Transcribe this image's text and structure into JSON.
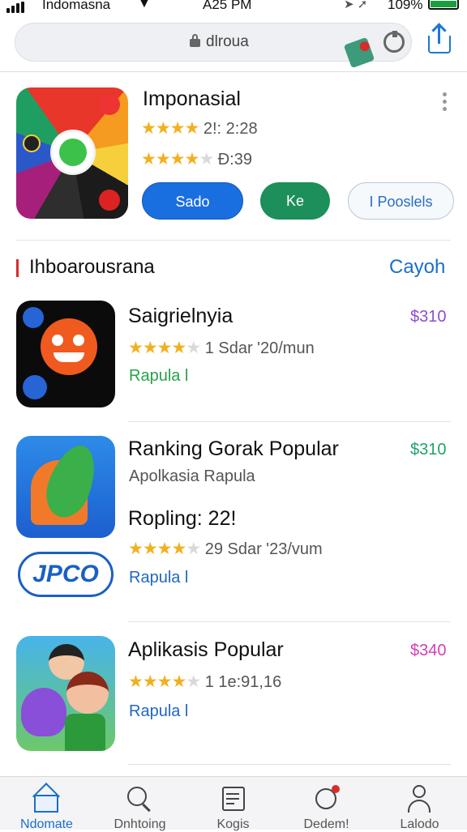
{
  "status_bar": {
    "carrier": "Indomasna",
    "time": "A25 PM",
    "battery": "109%"
  },
  "browser": {
    "url": "dlroua"
  },
  "featured": {
    "title": "Imponasial",
    "rating_line1": "2!: 2:28",
    "rating_line2": "Ð:39",
    "buttons": [
      "Sado",
      "Ke",
      "I Pooslels"
    ]
  },
  "section": {
    "title": "Ihboarousrana",
    "link": "Cayoh"
  },
  "apps": [
    {
      "title": "Saigrielnyia",
      "rating_text": "1 Sdar '20/mun",
      "price": "$310",
      "link": "Rapula l"
    },
    {
      "title": "Ranking Gorak Popular",
      "subtitle": "Apolkasia Rapula",
      "extra": "Ropling:  22!",
      "rating_text": "29 Sdar '23/vum",
      "price": "$310",
      "link": "Rapula l",
      "badge": "JPCO"
    },
    {
      "title": "Aplikasis Popular",
      "rating_text": "1 1e:91,16",
      "price": "$340",
      "link": "Rapula l"
    }
  ],
  "tabs": [
    {
      "label": "Ndomate",
      "icon": "home-icon"
    },
    {
      "label": "Dnhtoing",
      "icon": "search-icon"
    },
    {
      "label": "Kogis",
      "icon": "list-icon"
    },
    {
      "label": "Dedem!",
      "icon": "update-icon"
    },
    {
      "label": "Lalodo",
      "icon": "profile-icon"
    }
  ],
  "colors": {
    "accent_blue": "#1a6fe0",
    "green": "#1c8f5a",
    "star": "#f2b01e",
    "price_purple": "#8a4fd0",
    "price_green": "#1fa36a",
    "price_magenta": "#d23fb8"
  }
}
